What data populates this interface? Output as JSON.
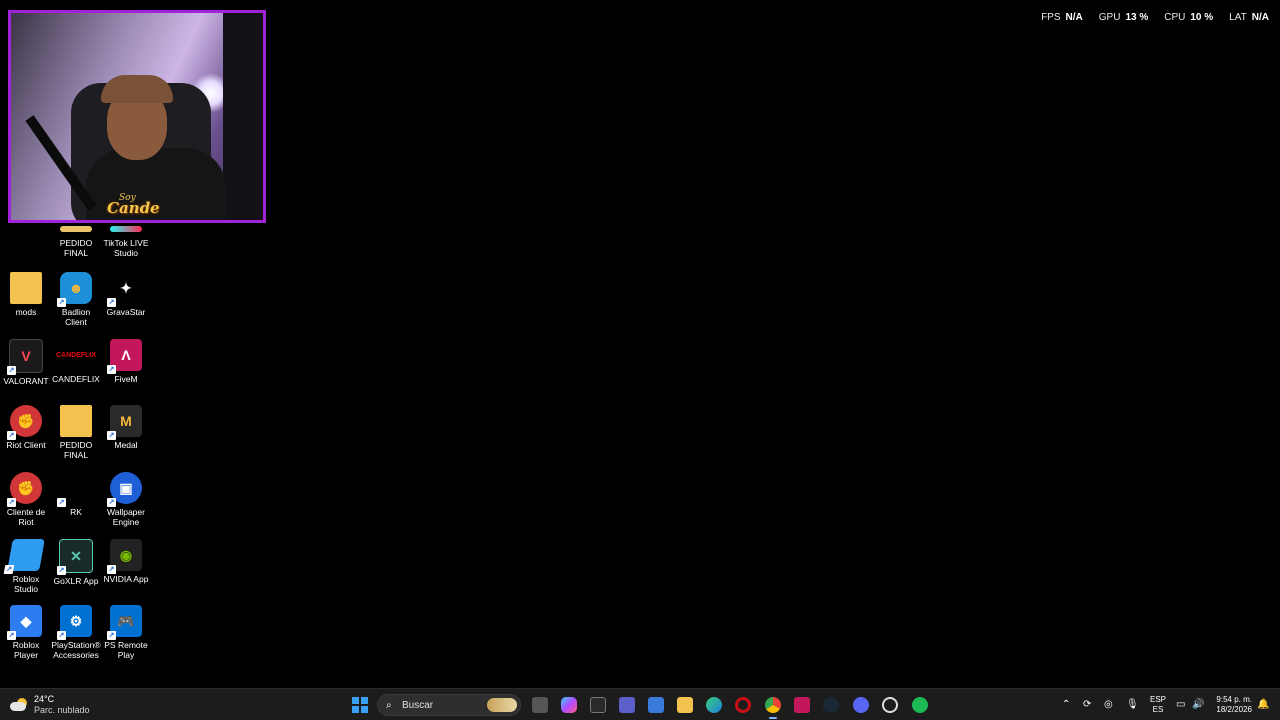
{
  "overlay": {
    "fps_label": "FPS",
    "fps_value": "N/A",
    "gpu_label": "GPU",
    "gpu_value": "13 %",
    "cpu_label": "CPU",
    "cpu_value": "10 %",
    "lat_label": "LAT",
    "lat_value": "N/A"
  },
  "webcam": {
    "badge": "Cande",
    "badge_sub": "Soy"
  },
  "desktop_icons": {
    "pedido_final_top": "PEDIDO FINAL",
    "tiktok_live": "TikTok LIVE Studio",
    "mods": "mods",
    "badlion": "Badlion Client",
    "gravastar": "GravaStar",
    "valorant": "VALORANT",
    "candeflix": "CANDEFLIX",
    "fivem": "FiveM",
    "riot_client": "Riot Client",
    "pedido_final": "PEDIDO FINAL",
    "medal": "Medal",
    "cliente_riot": "Cliente de Riot",
    "rk": "RK",
    "wallpaper_engine": "Wallpaper Engine",
    "roblox_studio": "Roblox Studio",
    "goxlr": "GoXLR App",
    "nvidia": "NVIDIA App",
    "roblox_player": "Roblox Player",
    "ps_accessories": "PlayStation® Accessories",
    "ps_remote": "PS Remote Play"
  },
  "taskbar": {
    "weather_temp": "24°C",
    "weather_desc": "Parc. nublado",
    "search_placeholder": "Buscar",
    "lang_top": "ESP",
    "lang_bottom": "ES",
    "time": "9:54 p. m.",
    "date": "18/2/2026"
  },
  "colors": {
    "accent": "#3aa0f5",
    "webcam_border": "#a023d8",
    "taskbar_bg": "#1c1c1c"
  }
}
